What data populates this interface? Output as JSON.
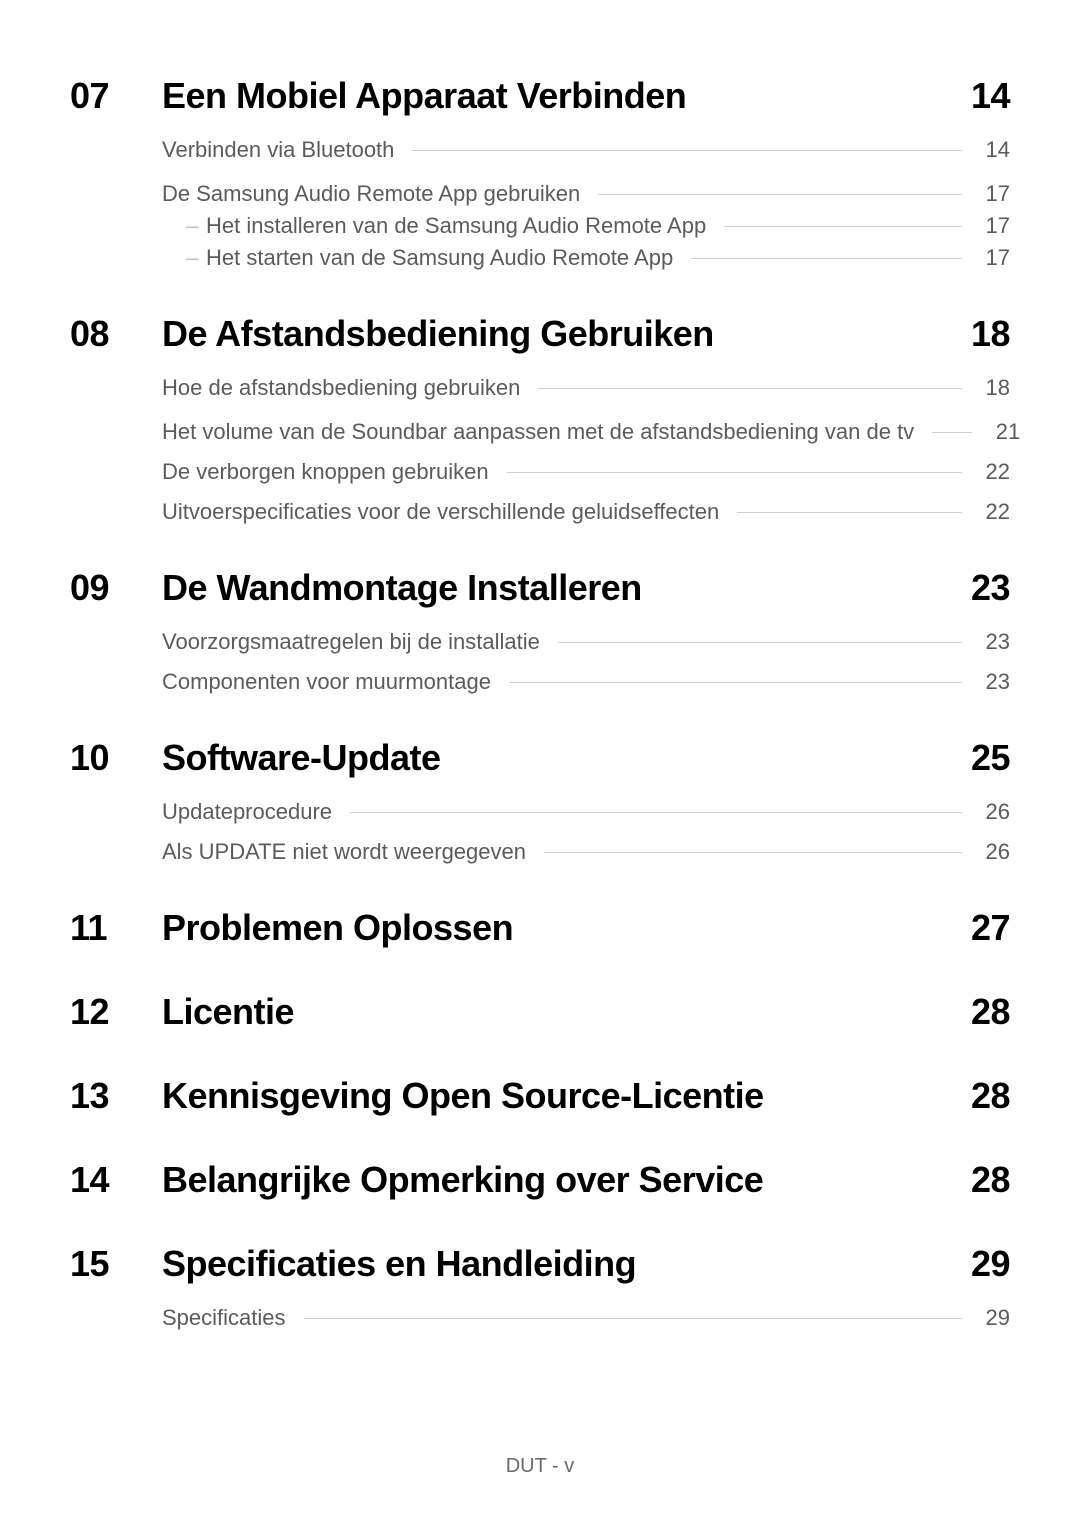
{
  "sections": [
    {
      "num": "07",
      "title": "Een Mobiel Apparaat Verbinden",
      "page": "14",
      "groups": [
        [
          {
            "title": "Verbinden via Bluetooth",
            "page": "14",
            "indent": 0
          }
        ],
        [
          {
            "title": "De Samsung Audio Remote App gebruiken",
            "page": "17",
            "indent": 0
          },
          {
            "title": "Het installeren van de Samsung Audio Remote App",
            "page": "17",
            "indent": 1
          },
          {
            "title": "Het starten van de Samsung Audio Remote App",
            "page": "17",
            "indent": 1
          }
        ]
      ]
    },
    {
      "num": "08",
      "title": "De Afstandsbediening Gebruiken",
      "page": "18",
      "groups": [
        [
          {
            "title": "Hoe de afstandsbediening gebruiken",
            "page": "18",
            "indent": 0
          }
        ],
        [
          {
            "title": "Het volume van de Soundbar aanpassen met de afstandsbediening van de tv",
            "page": "21",
            "indent": 0
          },
          {
            "title": "De verborgen knoppen gebruiken",
            "page": "22",
            "indent": 0
          },
          {
            "title": "Uitvoerspecificaties voor de verschillende geluidseffecten",
            "page": "22",
            "indent": 0
          }
        ]
      ]
    },
    {
      "num": "09",
      "title": "De Wandmontage Installeren",
      "page": "23",
      "groups": [
        [
          {
            "title": "Voorzorgsmaatregelen bij de installatie",
            "page": "23",
            "indent": 0
          },
          {
            "title": "Componenten voor muurmontage",
            "page": "23",
            "indent": 0
          }
        ]
      ]
    },
    {
      "num": "10",
      "title": "Software-Update",
      "page": "25",
      "groups": [
        [
          {
            "title": "Updateprocedure",
            "page": "26",
            "indent": 0
          },
          {
            "title": "Als UPDATE niet wordt weergegeven",
            "page": "26",
            "indent": 0
          }
        ]
      ]
    },
    {
      "num": "11",
      "title": "Problemen Oplossen",
      "page": "27",
      "groups": []
    },
    {
      "num": "12",
      "title": "Licentie",
      "page": "28",
      "groups": []
    },
    {
      "num": "13",
      "title": "Kennisgeving Open Source-Licentie",
      "page": "28",
      "groups": []
    },
    {
      "num": "14",
      "title": "Belangrijke Opmerking over Service",
      "page": "28",
      "groups": []
    },
    {
      "num": "15",
      "title": "Specificaties en Handleiding",
      "page": "29",
      "groups": [
        [
          {
            "title": "Specificaties",
            "page": "29",
            "indent": 0
          }
        ]
      ]
    }
  ],
  "dash_label": "–",
  "footer": "DUT - v"
}
